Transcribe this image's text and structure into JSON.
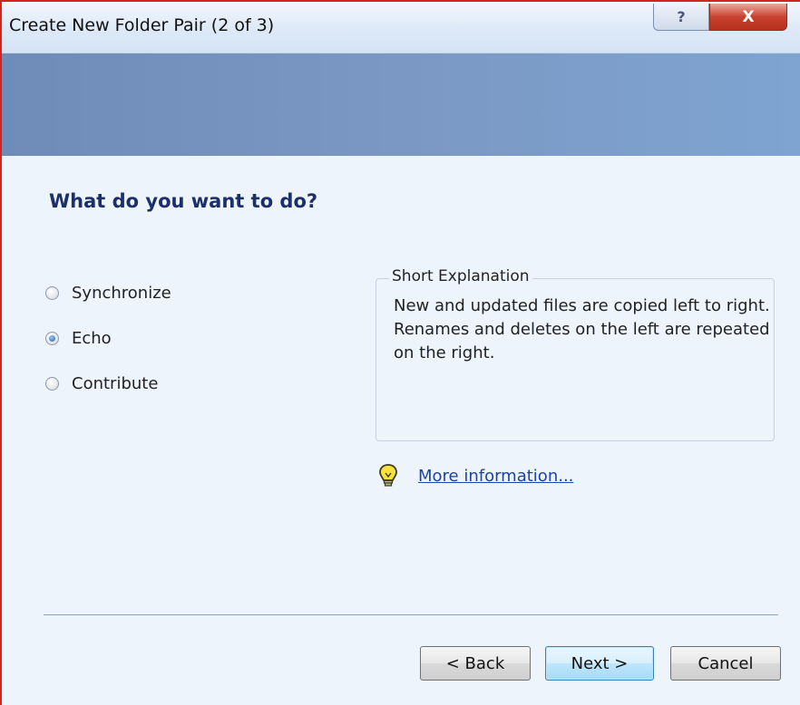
{
  "window": {
    "title": "Create New Folder Pair (2 of 3)",
    "help_glyph": "?",
    "close_glyph": "X"
  },
  "page": {
    "heading": "What do you want to do?"
  },
  "options": [
    {
      "label": "Synchronize",
      "selected": false
    },
    {
      "label": "Echo",
      "selected": true
    },
    {
      "label": "Contribute",
      "selected": false
    }
  ],
  "explanation": {
    "label": "Short Explanation",
    "text": "New and updated files are copied left to right. Renames and deletes on the left are repeated on the right."
  },
  "more_info": {
    "link_text": "More information...",
    "icon": "lightbulb-icon"
  },
  "buttons": {
    "back": "< Back",
    "next": "Next >",
    "cancel": "Cancel"
  },
  "colors": {
    "close_button": "#c8432f",
    "banner": "#7b98c4",
    "heading": "#1b2f6a",
    "link": "#1b43a8"
  }
}
